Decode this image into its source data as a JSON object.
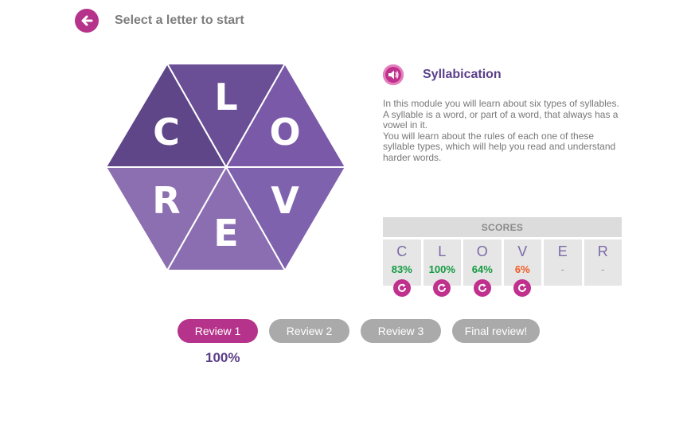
{
  "header": {
    "title": "Select a letter to start"
  },
  "hexagon": {
    "letters": [
      "L",
      "O",
      "V",
      "E",
      "R",
      "C"
    ],
    "colors": [
      "#6a4e96",
      "#7a5aa8",
      "#7f62ae",
      "#8b6eb2",
      "#8c6fb0",
      "#5f4689"
    ]
  },
  "module": {
    "title": "Syllabication",
    "description_1": "In this module you will learn about six types of syllables. A syllable is a word, or part of a word, that always has a vowel in it.",
    "description_2": "You will learn about the rules of each one of these syllable types, which will help you read and understand harder words."
  },
  "scores": {
    "header": "SCORES",
    "items": [
      {
        "letter": "C",
        "value": "83%",
        "status": "green",
        "retry": true
      },
      {
        "letter": "L",
        "value": "100%",
        "status": "green",
        "retry": true
      },
      {
        "letter": "O",
        "value": "64%",
        "status": "green",
        "retry": true
      },
      {
        "letter": "V",
        "value": "6%",
        "status": "orange",
        "retry": true
      },
      {
        "letter": "E",
        "value": "-",
        "status": "dash",
        "retry": false
      },
      {
        "letter": "R",
        "value": "-",
        "status": "dash",
        "retry": false
      }
    ]
  },
  "reviews": {
    "buttons": [
      {
        "label": "Review 1",
        "active": true
      },
      {
        "label": "Review 2",
        "active": false
      },
      {
        "label": "Review 3",
        "active": false
      },
      {
        "label": "Final review!",
        "active": false
      }
    ],
    "score": "100%"
  },
  "colors": {
    "accent": "#b5338a",
    "purple": "#5b3f8a",
    "green": "#129a40",
    "orange": "#f05a22"
  },
  "icons": {
    "back": "arrow-left-icon",
    "speaker": "speaker-icon",
    "retry": "refresh-icon"
  }
}
